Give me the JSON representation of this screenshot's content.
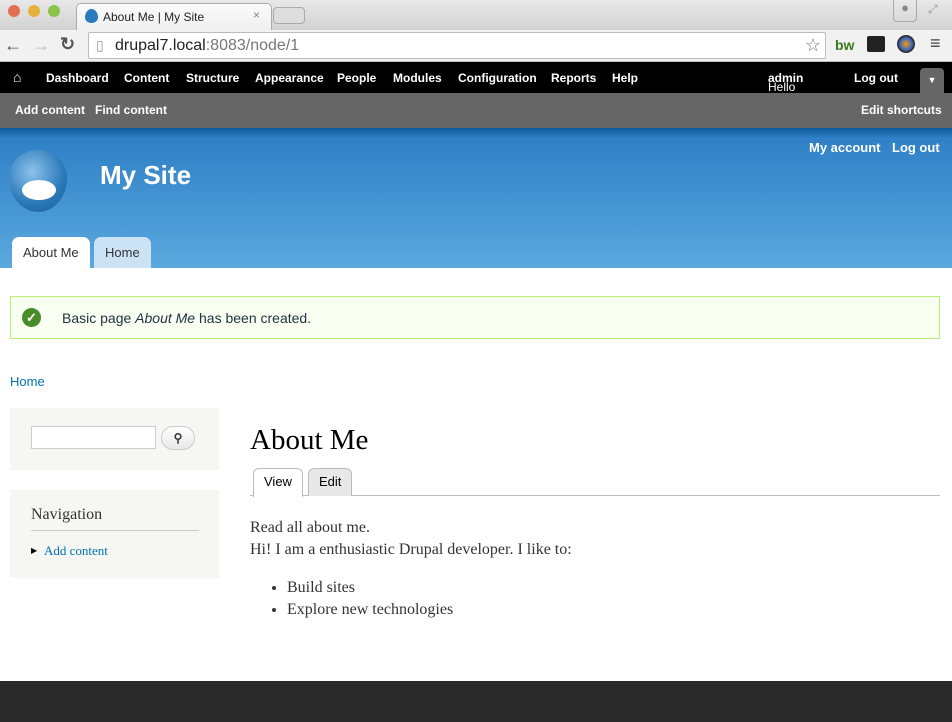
{
  "browser": {
    "tab_title": "About Me | My Site",
    "url_host": "drupal7.local",
    "url_rest": ":8083/node/1",
    "ext_bw": "bw"
  },
  "admin": {
    "items": [
      "Dashboard",
      "Content",
      "Structure",
      "Appearance",
      "People",
      "Modules",
      "Configuration",
      "Reports",
      "Help"
    ],
    "hello": "Hello ",
    "user": "admin",
    "logout": "Log out"
  },
  "shortcuts": {
    "add": "Add content",
    "find": "Find content",
    "edit": "Edit shortcuts"
  },
  "header": {
    "site_name": "My Site",
    "my_account": "My account",
    "logout": "Log out",
    "tabs": [
      "About Me",
      "Home"
    ]
  },
  "message": {
    "pre": "Basic page ",
    "em": "About Me",
    "post": " has been created."
  },
  "breadcrumb": "Home",
  "sidebar": {
    "search_value": "",
    "nav_title": "Navigation",
    "nav_items": [
      "Add content"
    ]
  },
  "content": {
    "title": "About Me",
    "tabs": [
      "View",
      "Edit"
    ],
    "p1": "Read all about me.",
    "p2": "Hi! I am a enthusiastic Drupal developer. I like to:",
    "list": [
      "Build sites",
      "Explore new technologies"
    ]
  },
  "colors": {
    "link": "#0071b3",
    "admin_bar": "#000000",
    "shortcut_bar": "#666666",
    "footer": "#292929"
  }
}
